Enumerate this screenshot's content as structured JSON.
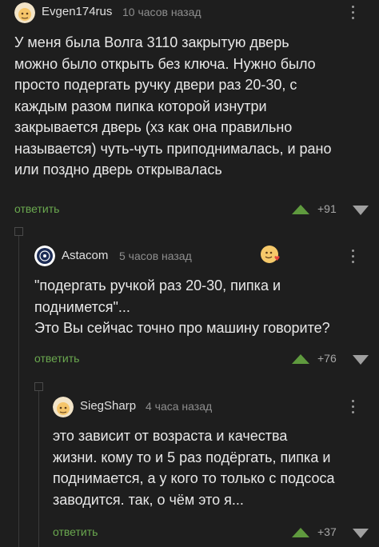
{
  "comments": [
    {
      "author": "Evgen174rus",
      "time": "10 часов назад",
      "lines": [
        "У меня была Волга 3110 закрытую дверь",
        "можно было открыть без ключа. Нужно было",
        "просто подергать ручку двери раз 20-30, с",
        "каждым разом пипка которой изнутри",
        "закрывается дверь (хз как она правильно",
        "называется) чуть-чуть приподнималась, и рано",
        "или поздно дверь открывалась"
      ],
      "reply_label": "ответить",
      "votes": "+91"
    },
    {
      "author": "Astacom",
      "time": "5 часов назад",
      "lines": [
        "\"подергать ручкой раз 20-30, пипка и",
        "поднимется\"...",
        "Это Вы сейчас точно про машину говорите?"
      ],
      "reply_label": "ответить",
      "votes": "+76"
    },
    {
      "author": "SiegSharp",
      "time": "4 часа назад",
      "lines": [
        "это зависит от возраста и качества",
        "жизни. кому то и 5 раз подёргать, пипка и",
        "поднимается, а у кого то только с подсоса",
        "заводится. так, о чём это я..."
      ],
      "reply_label": "ответить",
      "votes": "+37"
    }
  ],
  "icons": {
    "more": "more-vertical-icon",
    "upvote": "upvote-arrow-icon",
    "downvote": "downvote-arrow-icon",
    "reaction": "emoji-heart-icon",
    "collapse": "thread-collapse-icon"
  },
  "colors": {
    "background": "#1e1e1e",
    "reply_green": "#6aa84f",
    "upvote_green": "#5f9a3e",
    "text": "#e8e8e8",
    "muted": "#8e8e8e"
  }
}
